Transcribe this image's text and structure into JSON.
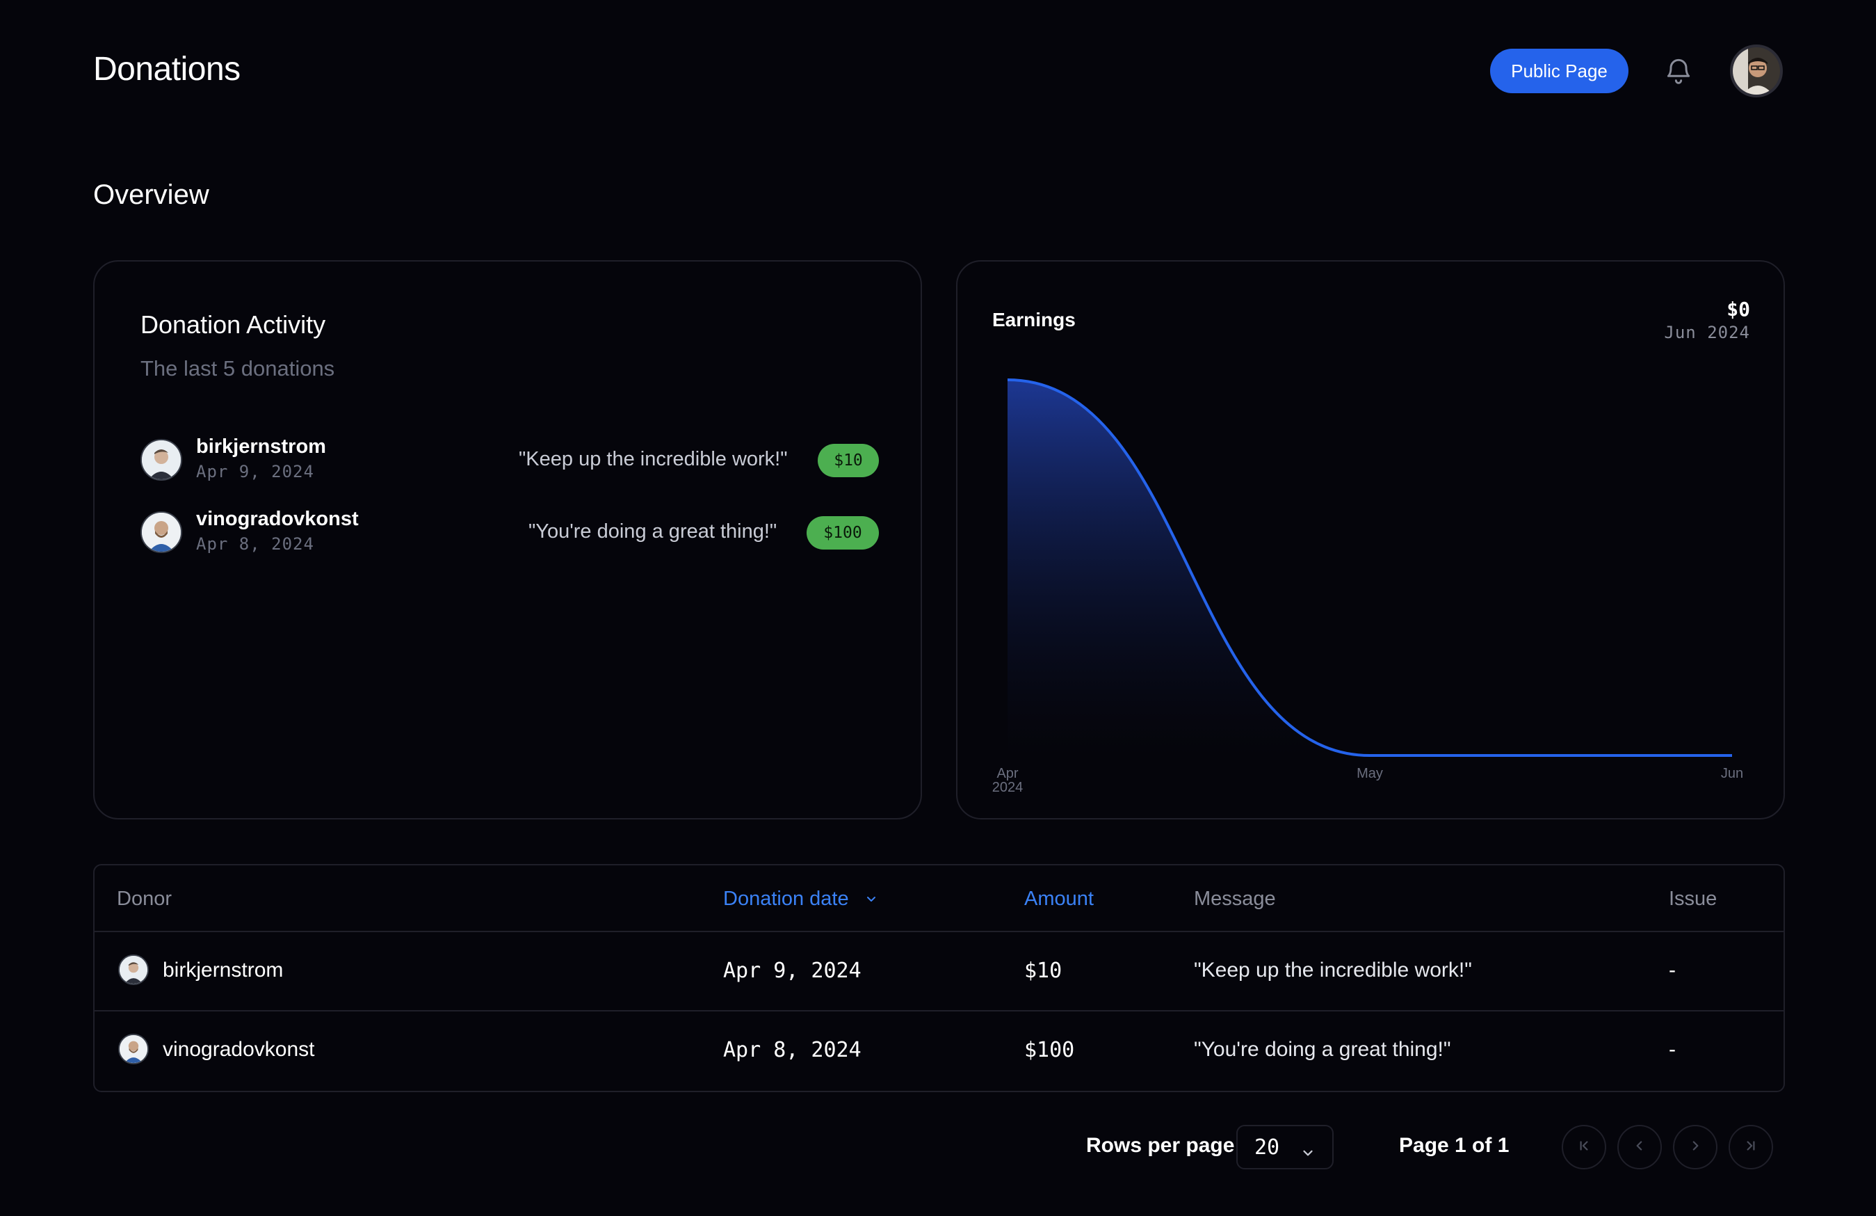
{
  "header": {
    "title": "Donations",
    "public_page_label": "Public Page"
  },
  "overview_title": "Overview",
  "activity": {
    "title": "Donation Activity",
    "subtitle": "The last 5 donations",
    "items": [
      {
        "name": "birkjernstrom",
        "date": "Apr 9, 2024",
        "message": "\"Keep up the incredible work!\"",
        "amount": "$10"
      },
      {
        "name": "vinogradovkonst",
        "date": "Apr 8, 2024",
        "message": "\"You're doing a great thing!\"",
        "amount": "$100"
      }
    ]
  },
  "earnings": {
    "title": "Earnings",
    "value": "$0",
    "month": "Jun 2024",
    "chart_data": {
      "type": "area",
      "x_ticks": [
        {
          "label": "Apr",
          "sublabel": "2024"
        },
        {
          "label": "May",
          "sublabel": ""
        },
        {
          "label": "Jun",
          "sublabel": ""
        }
      ],
      "series": [
        {
          "values": [
            110,
            0,
            0
          ]
        }
      ],
      "colors": {
        "line": "#2563eb",
        "fill_top": "#1e3a9a",
        "fill_bottom": "#05050b"
      },
      "grid": false
    }
  },
  "table": {
    "columns": {
      "donor": "Donor",
      "date": "Donation date",
      "amount": "Amount",
      "message": "Message",
      "issue": "Issue"
    },
    "sort_column": "date",
    "rows": [
      {
        "donor": "birkjernstrom",
        "date": "Apr 9, 2024",
        "amount": "$10",
        "message": "\"Keep up the incredible work!\"",
        "issue": "-"
      },
      {
        "donor": "vinogradovkonst",
        "date": "Apr 8, 2024",
        "amount": "$100",
        "message": "\"You're doing a great thing!\"",
        "issue": "-"
      }
    ]
  },
  "pagination": {
    "rows_per_page_label": "Rows per page",
    "rows_per_page_value": "20",
    "page_label": "Page 1 of 1"
  },
  "colors": {
    "background": "#05050b",
    "accent": "#2563eb",
    "badge_green": "#4caf50",
    "border": "#1f1f29",
    "muted_text": "#6b6f7f"
  }
}
